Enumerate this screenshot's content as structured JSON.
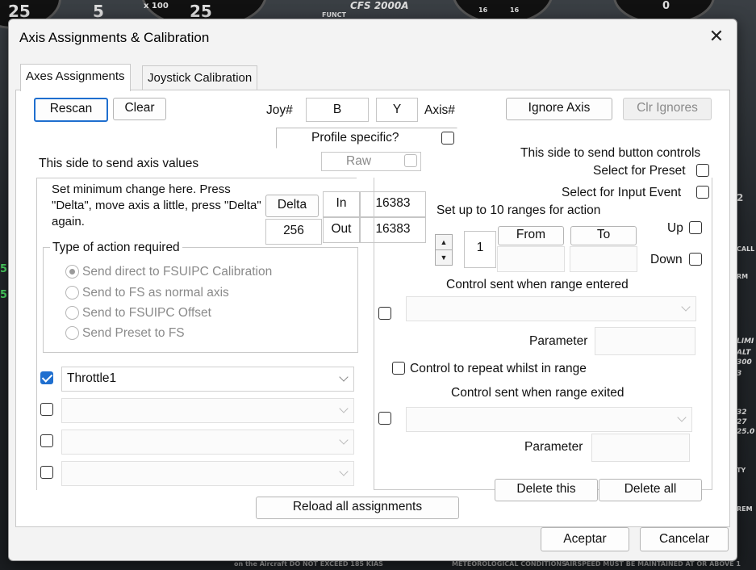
{
  "background": {
    "texts": [
      "25",
      "5",
      "25",
      "x 100",
      "CFS 2000A",
      "FUNCT",
      "16",
      "16",
      "0",
      "5",
      "5",
      "2",
      "CALL",
      "RM",
      "LIMI",
      "ALT",
      "300",
      "3",
      "32",
      "27",
      "25.0",
      "ITY",
      "REM",
      "on the Aircraft DO NOT EXCEED 185 KIAS",
      "METEOROLOGICAL CONDITIONS",
      "AIRSPEED MUST BE MAINTAINED AT OR ABOVE 1"
    ]
  },
  "window": {
    "title": "Axis Assignments & Calibration",
    "close_glyph": "✕"
  },
  "tabs": [
    {
      "label": "Axes Assignments",
      "active": true
    },
    {
      "label": "Joystick Calibration",
      "active": false
    }
  ],
  "top": {
    "rescan": "Rescan",
    "clear": "Clear",
    "joy_label": "Joy#",
    "joy_value": "B",
    "axis_value": "Y",
    "axis_label": "Axis#",
    "ignore_axis": "Ignore Axis",
    "clr_ignores": "Clr Ignores",
    "profile_specific": "Profile specific?",
    "raw": "Raw"
  },
  "left": {
    "heading": "This side to send axis values",
    "delta_help": "Set minimum change  here.  Press \"Delta\", move axis a little,  press \"Delta\" again.",
    "delta_button": "Delta",
    "delta_value": "256",
    "in_label": "In",
    "in_value": "16383",
    "out_label": "Out",
    "out_value": "16383",
    "type_group_title": "Type of action required",
    "radios": [
      {
        "label": "Send direct to FSUIPC Calibration",
        "selected": true
      },
      {
        "label": "Send to FS as normal axis",
        "selected": false
      },
      {
        "label": "Send to FSUIPC Offset",
        "selected": false
      },
      {
        "label": "Send Preset to FS",
        "selected": false
      }
    ],
    "assignments": [
      {
        "checked": true,
        "value": "Throttle1"
      },
      {
        "checked": false,
        "value": ""
      },
      {
        "checked": false,
        "value": ""
      },
      {
        "checked": false,
        "value": ""
      }
    ],
    "reload": "Reload all assignments"
  },
  "right": {
    "heading": "This side to send button controls",
    "select_preset": "Select for Preset",
    "select_input_event": "Select for Input Event",
    "ranges_heading": "Set up to 10 ranges for action",
    "range_index": "1",
    "from_label": "From",
    "to_label": "To",
    "up_label": "Up",
    "down_label": "Down",
    "entered_label": "Control sent when range entered",
    "parameter_label": "Parameter",
    "repeat_label": "Control to repeat whilst in range",
    "exited_label": "Control sent when range exited",
    "parameter_label2": "Parameter",
    "delete_this": "Delete this",
    "delete_all": "Delete all"
  },
  "footer": {
    "ok": "Aceptar",
    "cancel": "Cancelar"
  }
}
